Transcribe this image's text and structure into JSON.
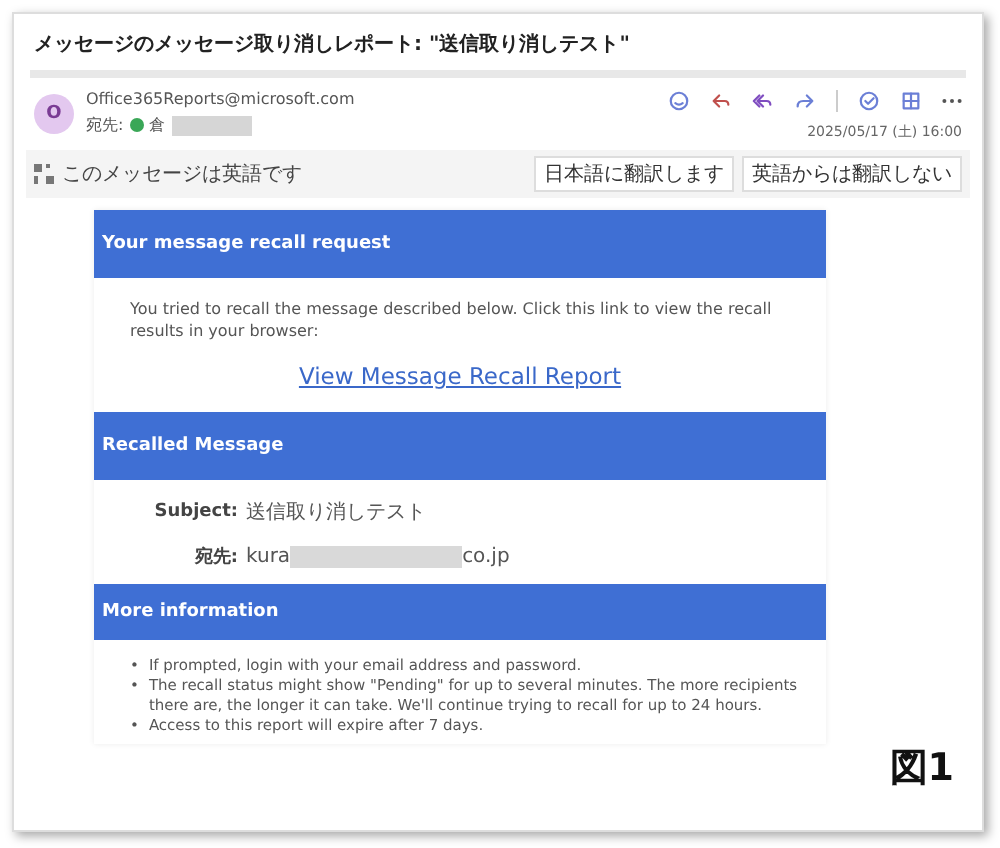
{
  "window": {
    "title": "メッセージのメッセージ取り消しレポート: \"送信取り消しテスト\""
  },
  "header": {
    "avatar": "O",
    "sender": "Office365Reports@microsoft.com",
    "to_label": "宛先:",
    "to_name": "倉",
    "date": "2025/05/17 (土) 16:00"
  },
  "translation_bar": {
    "message": "このメッセージは英語です",
    "buttons": [
      "日本語に翻訳します",
      "英語からは翻訳しない"
    ]
  },
  "sections": [
    {
      "heading": "Your message recall request",
      "kind": "text",
      "body": "You tried to recall the message described below. Click this link to view the recall results in your browser:",
      "link": "View Message Recall Report"
    },
    {
      "heading": "Recalled Message",
      "kind": "fields",
      "fields": [
        {
          "label": "Subject:",
          "value": "送信取り消しテスト"
        },
        {
          "label": "宛先:",
          "value": "kura",
          "redacted_tail": "co.jp"
        }
      ]
    },
    {
      "heading": "More information",
      "kind": "list",
      "bullet": "•",
      "items": [
        "If prompted, login with your email address and password.",
        "The recall status might show \"Pending\" for up to several minutes. The more recipients there are, the longer it can take. We'll continue trying to recall for up to 24 hours.",
        "Access to this report will expire after 7 days."
      ]
    }
  ],
  "figure_label": "図1"
}
